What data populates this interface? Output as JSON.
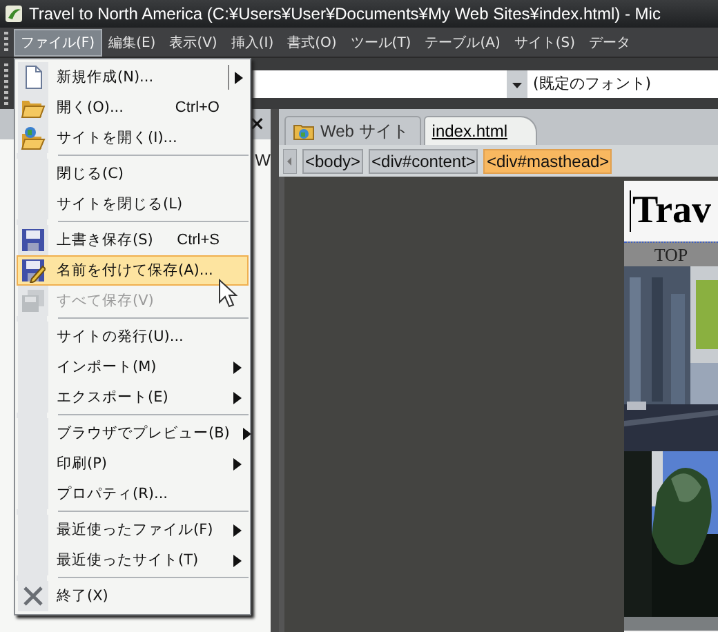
{
  "window": {
    "title": "Travel to North America (C:¥Users¥User¥Documents¥My Web Sites¥index.html) - Mic"
  },
  "menubar": {
    "items": [
      {
        "label": "ファイル(F)",
        "selected": true
      },
      {
        "label": "編集(E)",
        "selected": false
      },
      {
        "label": "表示(V)",
        "selected": false
      },
      {
        "label": "挿入(I)",
        "selected": false
      },
      {
        "label": "書式(O)",
        "selected": false
      },
      {
        "label": "ツール(T)",
        "selected": false
      },
      {
        "label": "テーブル(A)",
        "selected": false
      },
      {
        "label": "サイト(S)",
        "selected": false
      },
      {
        "label": "データ",
        "selected": false
      }
    ]
  },
  "toolbar": {
    "font_field": {
      "value": "(既定のフォント)"
    }
  },
  "left_panel": {
    "close": "×",
    "visible_text": "W"
  },
  "document_tabs": [
    {
      "label": "Web サイト",
      "selected": false
    },
    {
      "label": "index.html",
      "selected": true
    }
  ],
  "breadcrumb": [
    {
      "label": "<body>",
      "selected": false
    },
    {
      "label": "<div#content>",
      "selected": false
    },
    {
      "label": "<div#masthead>",
      "selected": true
    }
  ],
  "preview": {
    "heading": "Trav",
    "nav": "TOP"
  },
  "file_menu": [
    {
      "kind": "item",
      "label": "新規作成(N)...",
      "submenu": true,
      "split": true,
      "disabled": false,
      "selected": false
    },
    {
      "kind": "item",
      "label": "開く(O)...",
      "shortcut": "Ctrl+O",
      "disabled": false,
      "selected": false
    },
    {
      "kind": "item",
      "label": "サイトを開く(I)...",
      "disabled": false,
      "selected": false
    },
    {
      "kind": "separator"
    },
    {
      "kind": "item",
      "label": "閉じる(C)",
      "disabled": false,
      "selected": false
    },
    {
      "kind": "item",
      "label": "サイトを閉じる(L)",
      "disabled": false,
      "selected": false
    },
    {
      "kind": "separator"
    },
    {
      "kind": "item",
      "label": "上書き保存(S)",
      "shortcut": "Ctrl+S",
      "disabled": false,
      "selected": false
    },
    {
      "kind": "item",
      "label": "名前を付けて保存(A)...",
      "disabled": false,
      "selected": true
    },
    {
      "kind": "item",
      "label": "すべて保存(V)",
      "disabled": true,
      "selected": false
    },
    {
      "kind": "separator"
    },
    {
      "kind": "item",
      "label": "サイトの発行(U)...",
      "disabled": false,
      "selected": false
    },
    {
      "kind": "item",
      "label": "インポート(M)",
      "submenu": true,
      "disabled": false,
      "selected": false
    },
    {
      "kind": "item",
      "label": "エクスポート(E)",
      "submenu": true,
      "disabled": false,
      "selected": false
    },
    {
      "kind": "separator"
    },
    {
      "kind": "item",
      "label": "ブラウザでプレビュー(B)",
      "submenu": true,
      "disabled": false,
      "selected": false
    },
    {
      "kind": "item",
      "label": "印刷(P)",
      "submenu": true,
      "disabled": false,
      "selected": false
    },
    {
      "kind": "item",
      "label": "プロパティ(R)...",
      "disabled": false,
      "selected": false
    },
    {
      "kind": "separator"
    },
    {
      "kind": "item",
      "label": "最近使ったファイル(F)",
      "submenu": true,
      "disabled": false,
      "selected": false
    },
    {
      "kind": "item",
      "label": "最近使ったサイト(T)",
      "submenu": true,
      "disabled": false,
      "selected": false
    },
    {
      "kind": "separator"
    },
    {
      "kind": "item",
      "label": "終了(X)",
      "disabled": false,
      "selected": false
    }
  ]
}
